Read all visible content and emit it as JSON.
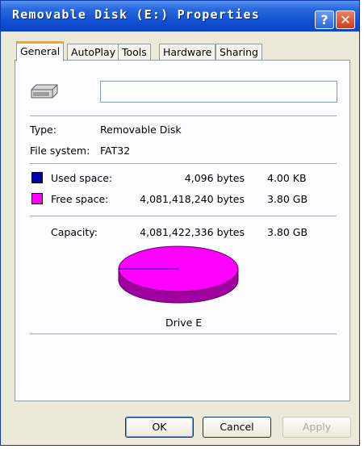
{
  "window": {
    "title": "Removable Disk (E:) Properties",
    "help_glyph": "?",
    "close_glyph": "✕"
  },
  "tabs": [
    {
      "label": "General",
      "active": true
    },
    {
      "label": "AutoPlay",
      "active": false
    },
    {
      "label": "Tools",
      "active": false
    },
    {
      "label": "Hardware",
      "active": false
    },
    {
      "label": "Sharing",
      "active": false
    }
  ],
  "general": {
    "drive_icon": "removable-disk-icon",
    "name_value": "",
    "type_label": "Type:",
    "type_value": "Removable Disk",
    "fs_label": "File system:",
    "fs_value": "FAT32",
    "used": {
      "label": "Used space:",
      "bytes": "4,096 bytes",
      "size": "4.00 KB",
      "color": "#0000aa"
    },
    "free": {
      "label": "Free space:",
      "bytes": "4,081,418,240 bytes",
      "size": "3.80 GB",
      "color": "#ff00ff"
    },
    "capacity": {
      "label": "Capacity:",
      "bytes": "4,081,422,336 bytes",
      "size": "3.80 GB"
    },
    "pie": {
      "used_fraction": 1e-06,
      "caption": "Drive E"
    }
  },
  "buttons": {
    "ok": "OK",
    "cancel": "Cancel",
    "apply": "Apply"
  }
}
